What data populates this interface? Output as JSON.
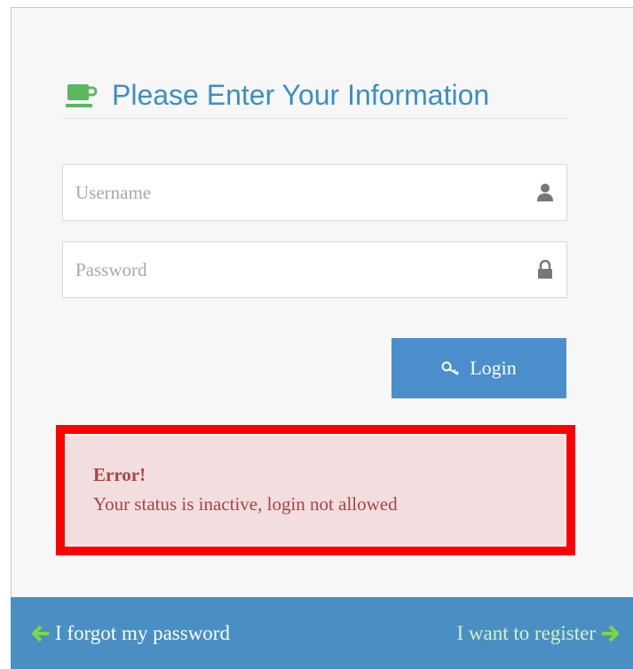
{
  "form": {
    "title": "Please Enter Your Information",
    "username_placeholder": "Username",
    "username_value": "",
    "password_placeholder": "Password",
    "password_value": "",
    "login_label": "Login"
  },
  "error": {
    "title": "Error!",
    "message": "Your status is inactive, login not allowed"
  },
  "footer": {
    "forgot_label": "I forgot my password",
    "register_label": "I want to register"
  },
  "colors": {
    "accent": "#3a8fc4",
    "button": "#4a8fcb",
    "footer": "#4a8fc3",
    "cup_icon": "#5cb85c",
    "error_bg": "#f2dede",
    "error_text": "#a94442",
    "highlight_border": "#ff0000",
    "arrow_icon": "#7fd63f"
  },
  "icons": {
    "header": "coffee-cup-icon",
    "username": "user-icon",
    "password": "lock-icon",
    "login": "key-icon",
    "forgot": "arrow-left-icon",
    "register": "arrow-right-icon"
  }
}
